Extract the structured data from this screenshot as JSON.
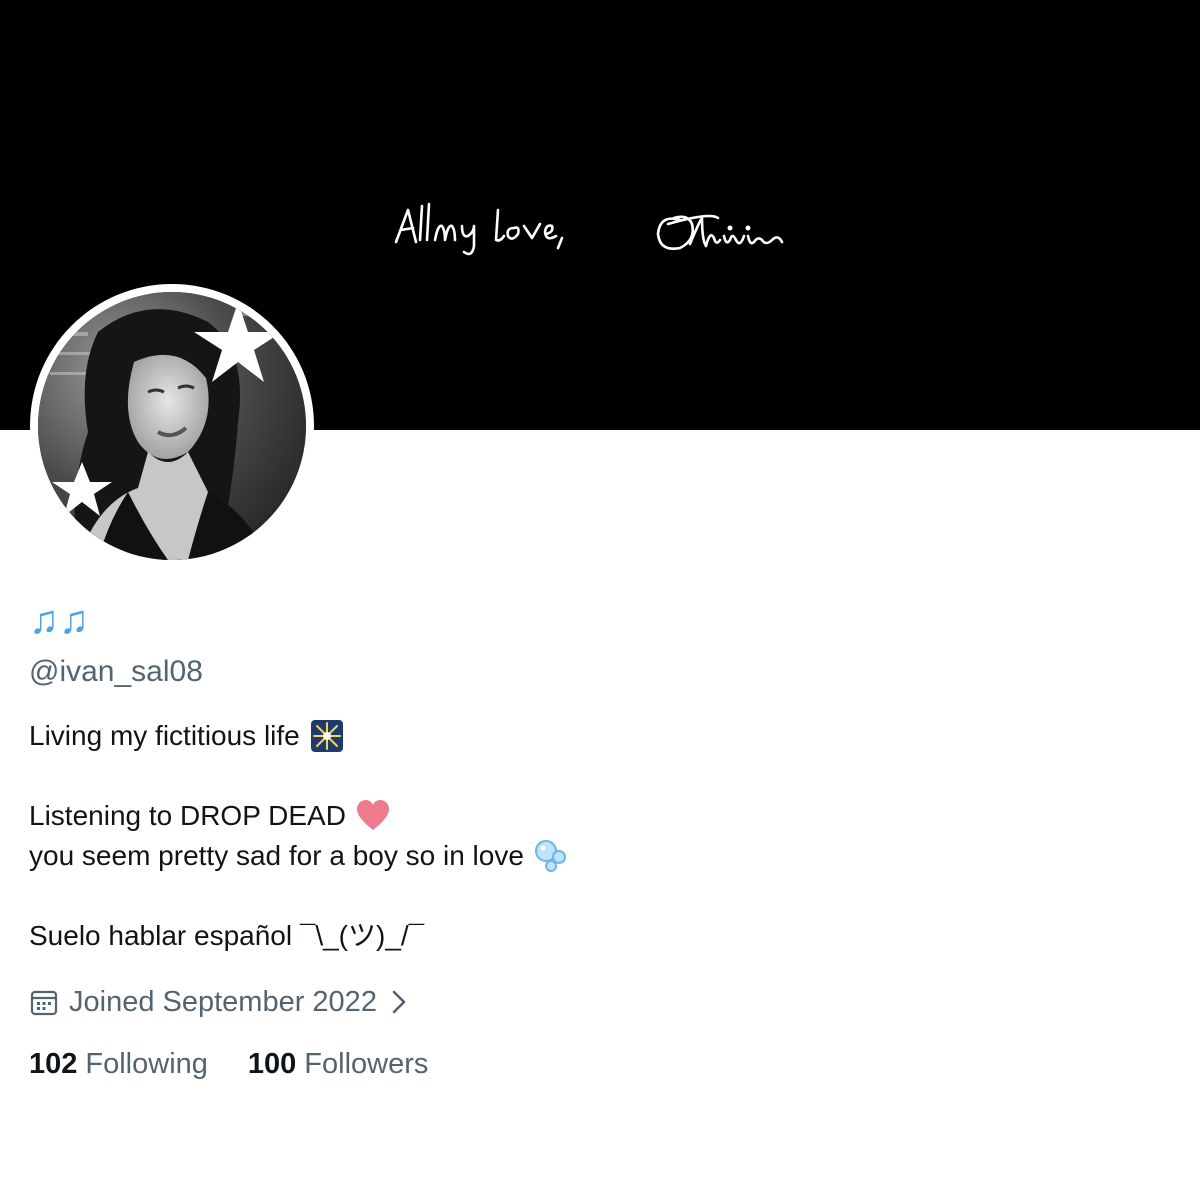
{
  "banner": {
    "signature": "All my love, Olivia"
  },
  "profile": {
    "display_name": "♫♫",
    "handle": "@ivan_sal08",
    "bio": {
      "line1": "Living my fictitious life",
      "line2": "Listening to DROP DEAD",
      "line3": "you seem pretty sad for a boy so in love",
      "line4": "Suelo hablar español ¯\\_(ツ)_/¯"
    },
    "joined": "Joined September 2022",
    "following_count": "102",
    "following_label": "Following",
    "followers_count": "100",
    "followers_label": "Followers"
  },
  "icons": {
    "joined": "calendar-icon",
    "joined_chevron": "chevron-right-icon",
    "bio_line1": "sparkler-emoji",
    "bio_line2": "heart-emoji",
    "bio_line3": "bubbles-emoji"
  },
  "colors": {
    "banner": "#000000",
    "name": "#4ba3e3",
    "secondary_text": "#536471",
    "primary_text": "#0f1419",
    "heart": "#ef7a8c"
  }
}
